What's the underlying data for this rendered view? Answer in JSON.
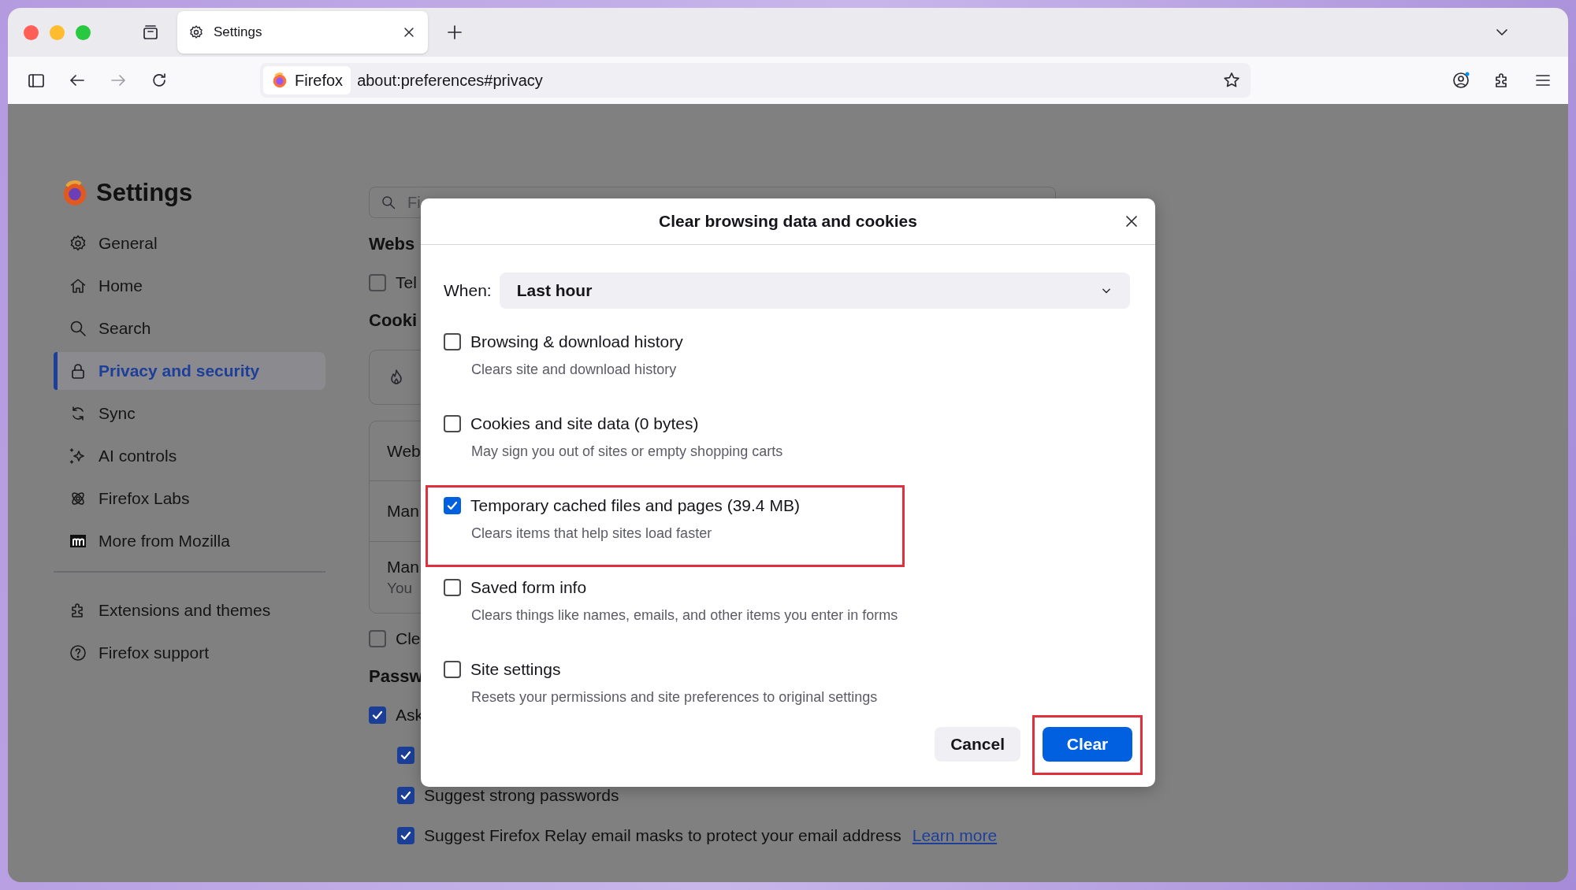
{
  "browser": {
    "tabs": [
      {
        "title": "Settings",
        "selected": true
      }
    ],
    "identity": "Firefox",
    "url": "about:preferences#privacy"
  },
  "sidebar": {
    "title": "Settings",
    "items": [
      {
        "label": "General",
        "selected": false
      },
      {
        "label": "Home",
        "selected": false
      },
      {
        "label": "Search",
        "selected": false
      },
      {
        "label": "Privacy and security",
        "selected": true
      },
      {
        "label": "Sync",
        "selected": false
      },
      {
        "label": "AI controls",
        "selected": false
      },
      {
        "label": "Firefox Labs",
        "selected": false
      },
      {
        "label": "More from Mozilla",
        "selected": false
      }
    ],
    "footer_items": [
      {
        "label": "Extensions and themes",
        "selected": false
      },
      {
        "label": "Firefox support",
        "selected": false
      }
    ]
  },
  "page": {
    "search_placeholder": "Fi",
    "blocks": [
      {
        "kind": "heading",
        "text": "Webs"
      },
      {
        "kind": "checkbox",
        "text": "Tel",
        "checked": false
      },
      {
        "kind": "heading",
        "text": "Cooki"
      },
      {
        "kind": "flame-card"
      },
      {
        "kind": "card-group",
        "rows": [
          {
            "text": "Web"
          },
          {
            "text": "Man"
          },
          {
            "text": "Man",
            "subtext": "You"
          }
        ]
      },
      {
        "kind": "checkbox",
        "text": "Cle",
        "checked": false
      },
      {
        "kind": "heading",
        "text": "Passw"
      },
      {
        "kind": "checkbox",
        "text": "Ask",
        "checked": true,
        "children": [
          {
            "checked": true
          },
          {
            "text": "Suggest strong passwords",
            "checked": true
          },
          {
            "text": "Suggest Firefox Relay email masks to protect your email address",
            "link": "Learn more",
            "checked": true
          }
        ]
      }
    ]
  },
  "dialog": {
    "title": "Clear browsing data and cookies",
    "when_label": "When:",
    "when_value": "Last hour",
    "options": [
      {
        "label": "Browsing & download history",
        "description": "Clears site and download history",
        "checked": false,
        "highlighted": false
      },
      {
        "label": "Cookies and site data (0 bytes)",
        "description": "May sign you out of sites or empty shopping carts",
        "checked": false,
        "highlighted": false
      },
      {
        "label": "Temporary cached files and pages (39.4 MB)",
        "description": "Clears items that help sites load faster",
        "checked": true,
        "highlighted": true
      },
      {
        "label": "Saved form info",
        "description": "Clears things like names, emails, and other items you enter in forms",
        "checked": false,
        "highlighted": false
      },
      {
        "label": "Site settings",
        "description": "Resets your permissions and site preferences to original settings",
        "checked": false,
        "highlighted": false
      }
    ],
    "buttons": [
      {
        "label": "Cancel",
        "kind": "secondary",
        "highlighted": false
      },
      {
        "label": "Clear",
        "kind": "primary",
        "highlighted": true
      }
    ]
  }
}
